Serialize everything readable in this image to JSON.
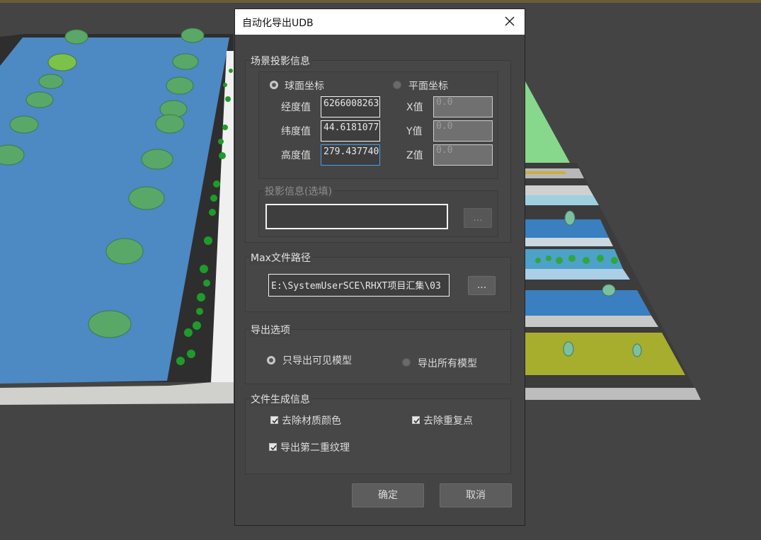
{
  "dialog": {
    "title": "自动化导出UDB",
    "close_icon": "close-icon"
  },
  "projection": {
    "group_label": "场景投影信息",
    "spherical_label": "球面坐标",
    "planar_label": "平面坐标",
    "spherical_selected": true,
    "longitude_label": "经度值",
    "latitude_label": "纬度值",
    "height_label": "高度值",
    "longitude_value": "6266008263",
    "latitude_value": "44.6181077",
    "height_value": "279.437740",
    "x_label": "X值",
    "y_label": "Y值",
    "z_label": "Z值",
    "x_value": "0.0",
    "y_value": "0.0",
    "z_value": "0.0",
    "proj_info_label": "投影信息(选填)",
    "proj_info_value": "",
    "proj_browse_label": "..."
  },
  "max_path": {
    "group_label": "Max文件路径",
    "value": "E:\\SystemUserSCE\\RHXT项目汇集\\03",
    "browse_label": "..."
  },
  "export_options": {
    "group_label": "导出选项",
    "visible_only_label": "只导出可见模型",
    "all_models_label": "导出所有模型",
    "visible_only_selected": true
  },
  "file_info": {
    "group_label": "文件生成信息",
    "remove_material_color_label": "去除材质颜色",
    "remove_duplicate_points_label": "去除重复点",
    "export_second_texture_label": "导出第二重纹理",
    "remove_material_color_checked": true,
    "remove_duplicate_points_checked": true,
    "export_second_texture_checked": true
  },
  "buttons": {
    "ok_label": "确定",
    "cancel_label": "取消"
  },
  "colors": {
    "dialog_bg": "#444444",
    "water": "#4a86c0",
    "grass_green": "#86d48a",
    "olive": "#a8ad2e"
  }
}
